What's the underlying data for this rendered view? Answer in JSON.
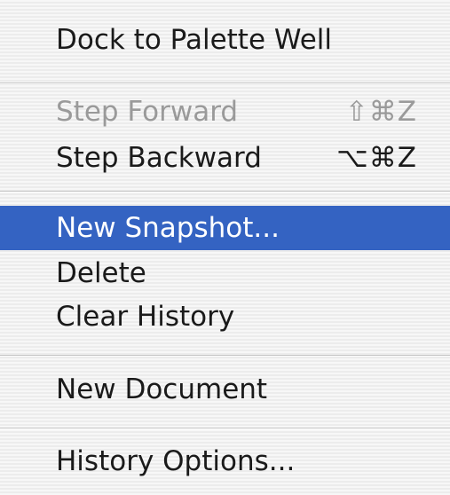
{
  "menu": {
    "items": [
      {
        "label": "Dock to Palette Well",
        "shortcut": "",
        "state": "enabled"
      },
      {
        "label": "Step Forward",
        "shortcut": "⇧⌘Z",
        "state": "disabled"
      },
      {
        "label": "Step Backward",
        "shortcut": "⌥⌘Z",
        "state": "enabled"
      },
      {
        "label": "New Snapshot...",
        "shortcut": "",
        "state": "highlighted"
      },
      {
        "label": "Delete",
        "shortcut": "",
        "state": "enabled"
      },
      {
        "label": "Clear History",
        "shortcut": "",
        "state": "enabled"
      },
      {
        "label": "New Document",
        "shortcut": "",
        "state": "enabled"
      },
      {
        "label": "History Options...",
        "shortcut": "",
        "state": "enabled"
      }
    ]
  },
  "colors": {
    "highlight": "#3463c2",
    "highlight_text": "#ffffff",
    "text": "#1a1a1a",
    "disabled_text": "#9a9a9a"
  }
}
